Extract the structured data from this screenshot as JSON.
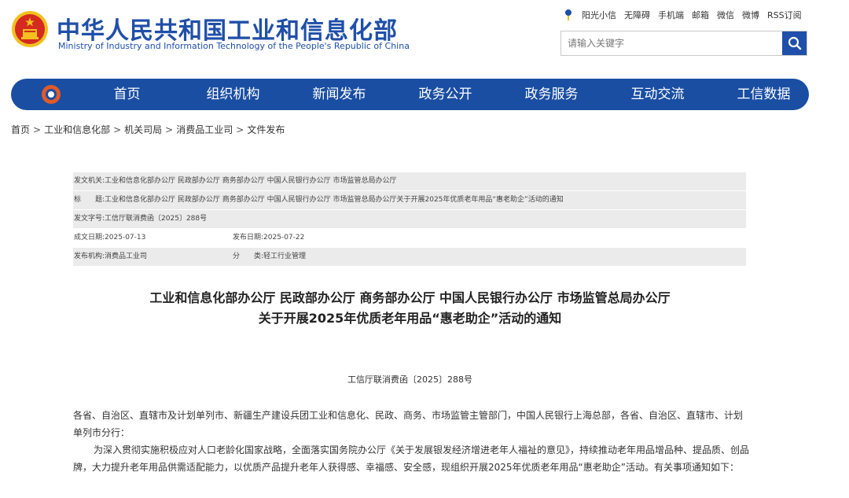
{
  "header": {
    "title": "中华人民共和国工业和信息化部",
    "subtitle": "Ministry of Industry and Information Technology of the People's Republic of China",
    "top_links": [
      "阳光小信",
      "无障碍",
      "手机端",
      "邮箱",
      "微信",
      "微博",
      "RSS订阅"
    ],
    "search_placeholder": "请输入关键字"
  },
  "nav": {
    "items": [
      "首页",
      "组织机构",
      "新闻发布",
      "政务公开",
      "政务服务",
      "互动交流",
      "工信数据"
    ]
  },
  "breadcrumb": [
    "首页",
    "工业和信息化部",
    "机关司局",
    "消费品工业司",
    "文件发布"
  ],
  "meta": {
    "issuer_label": "发文机关:",
    "issuer": "工业和信息化部办公厅 民政部办公厅 商务部办公厅 中国人民银行办公厅 市场监管总局办公厅",
    "title_label": "标　　题:",
    "title": "工业和信息化部办公厅 民政部办公厅 商务部办公厅 中国人民银行办公厅 市场监管总局办公厅关于开展2025年优质老年用品“惠老助企”活动的通知",
    "doc_no_label": "发文字号:",
    "doc_no": "工信厅联消费函〔2025〕288号",
    "created_label": "成文日期:",
    "created": "2025-07-13",
    "published_label": "发布日期:",
    "published": "2025-07-22",
    "org_label": "发布机构:",
    "org": "消费品工业司",
    "category_label": "分　　类:",
    "category": "轻工行业管理"
  },
  "article": {
    "title_line1": "工业和信息化部办公厅 民政部办公厅 商务部办公厅 中国人民银行办公厅 市场监管总局办公厅",
    "title_line2": "关于开展2025年优质老年用品“惠老助企”活动的通知",
    "doc_number": "工信厅联消费函〔2025〕288号",
    "recipients": "各省、自治区、直辖市及计划单列市、新疆生产建设兵团工业和信息化、民政、商务、市场监管主管部门，中国人民银行上海总部，各省、自治区、直辖市、计划单列市分行：",
    "paragraph1": "为深入贯彻实施积极应对人口老龄化国家战略，全面落实国务院办公厅《关于发展银发经济增进老年人福祉的意见》，持续推动老年用品增品种、提品质、创品牌，大力提升老年用品供需适配能力，以优质产品提升老年人获得感、幸福感、安全感，现组织开展2025年优质老年用品“惠老助企”活动。有关事项通知如下："
  },
  "colors": {
    "brand_blue": "#1a4ea3",
    "emblem_red": "#d42a1f",
    "emblem_gold": "#f3c020"
  }
}
